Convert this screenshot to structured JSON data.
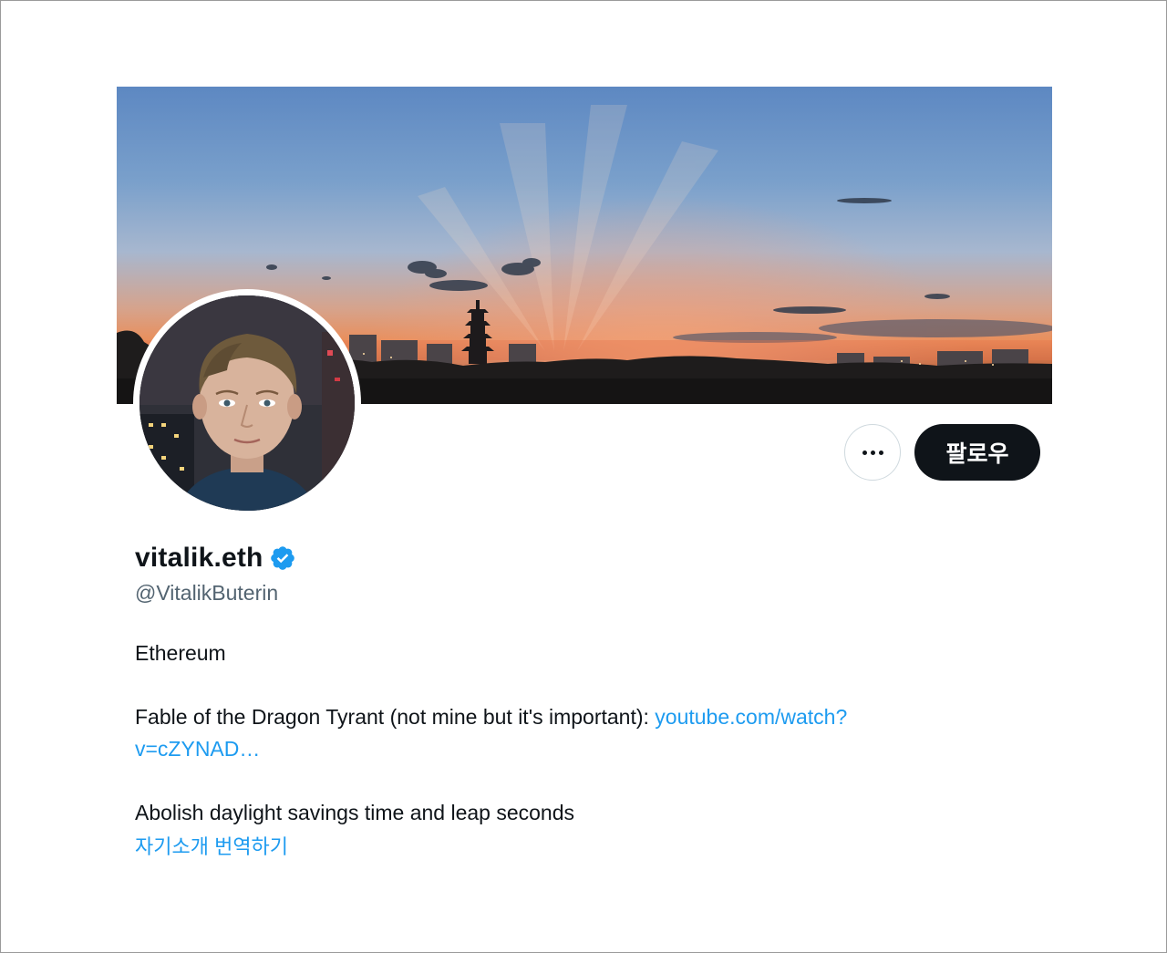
{
  "profile": {
    "display_name": "vitalik.eth",
    "handle": "@VitalikButerin",
    "verified_icon": "verified-badge-icon",
    "bio": {
      "line1": "Ethereum",
      "line2_text": "Fable of the Dragon Tyrant (not mine but it's important): ",
      "line2_link_a": "youtube.com/watch?",
      "line2_link_b": "v=cZYNAD…",
      "line3": "Abolish daylight savings time and leap seconds"
    },
    "translate_label": "자기소개 번역하기"
  },
  "actions": {
    "more_icon": "more-horizontal-icon",
    "follow_label": "팔로우"
  },
  "colors": {
    "link": "#1d9bf0",
    "text": "#0f1419",
    "secondary": "#536471",
    "follow_bg": "#0f1419"
  }
}
